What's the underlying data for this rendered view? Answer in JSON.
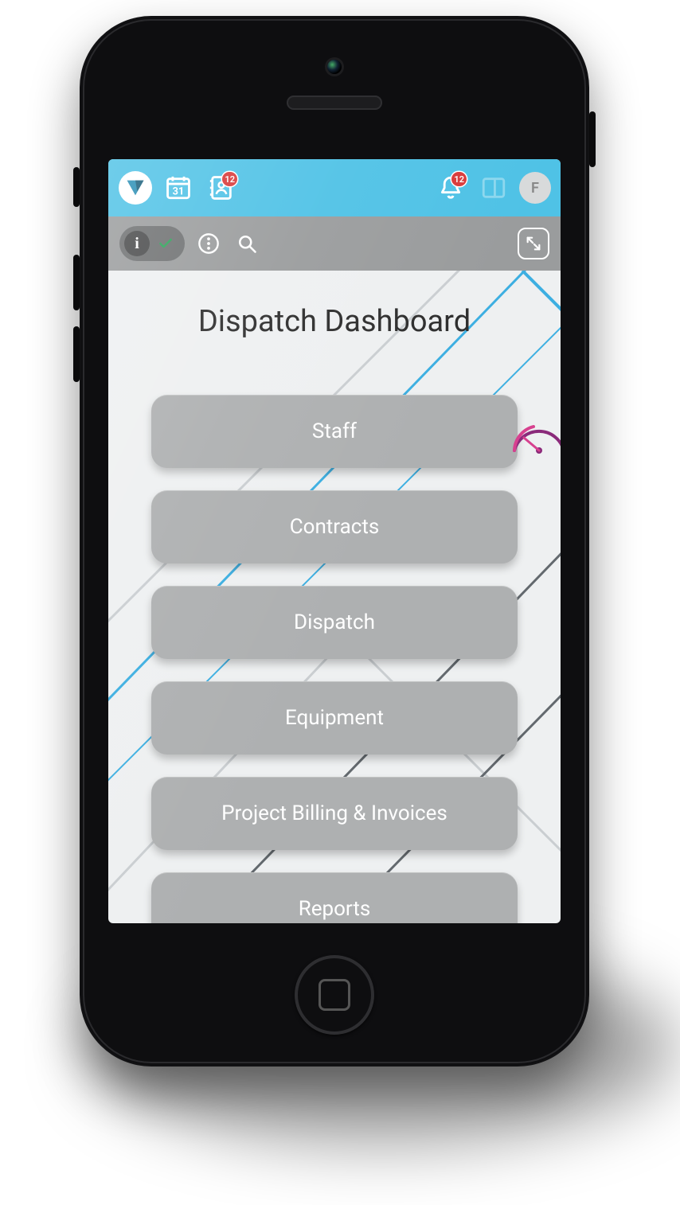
{
  "appbar": {
    "calendar_day": "31",
    "contacts_badge": "12",
    "notifications_badge": "12",
    "avatar_initial": "F"
  },
  "toolbar": {
    "info_glyph": "i"
  },
  "page": {
    "title": "Dispatch Dashboard"
  },
  "tiles": [
    {
      "label": "Staff"
    },
    {
      "label": "Contracts"
    },
    {
      "label": "Dispatch"
    },
    {
      "label": "Equipment"
    },
    {
      "label": "Project Billing & Invoices"
    },
    {
      "label": "Reports"
    }
  ],
  "colors": {
    "appbar": "#4fc2e6",
    "toolbar": "#9a9c9d",
    "tile": "#aeb0b1",
    "badge": "#d83a3a",
    "accent_line_blue": "#2aa8e0",
    "accent_line_grey": "#555b60"
  }
}
